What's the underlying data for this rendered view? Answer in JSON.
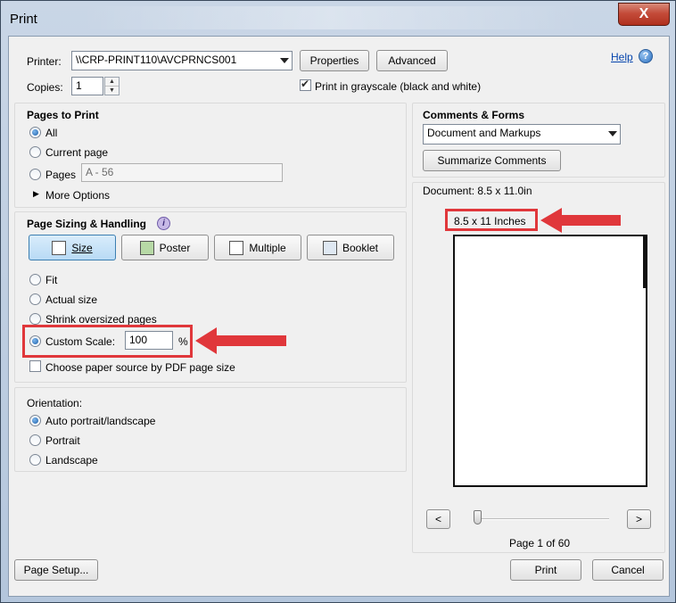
{
  "window": {
    "title": "Print",
    "close_glyph": "X"
  },
  "printer": {
    "label": "Printer:",
    "value": "\\\\CRP-PRINT110\\AVCPRNCS001",
    "properties_label": "Properties",
    "advanced_label": "Advanced",
    "help_label": "Help",
    "help_icon": "?"
  },
  "copies": {
    "label": "Copies:",
    "value": "1",
    "grayscale_label": "Print in grayscale (black and white)",
    "grayscale_checked": true
  },
  "pages_to_print": {
    "title": "Pages to Print",
    "options": [
      "All",
      "Current page",
      "Pages"
    ],
    "selected": "All",
    "pages_value": "A - 56",
    "more_options_label": "More Options"
  },
  "sizing": {
    "title": "Page Sizing & Handling",
    "info_icon": "i",
    "mode_buttons": [
      "Size",
      "Poster",
      "Multiple",
      "Booklet"
    ],
    "active_mode": "Size",
    "options": [
      "Fit",
      "Actual size",
      "Shrink oversized pages",
      "Custom Scale:"
    ],
    "selected": "Custom Scale:",
    "custom_scale_value": "100",
    "percent_sign": "%",
    "paper_source_label": "Choose paper source by PDF page size",
    "paper_source_checked": false
  },
  "orientation": {
    "title": "Orientation:",
    "options": [
      "Auto portrait/landscape",
      "Portrait",
      "Landscape"
    ],
    "selected": "Auto portrait/landscape"
  },
  "comments_forms": {
    "title": "Comments & Forms",
    "value": "Document and Markups",
    "summarize_label": "Summarize Comments"
  },
  "preview": {
    "document_size": "Document: 8.5 x 11.0in",
    "paper_label": "8.5 x 11 Inches",
    "prev_label": "<",
    "next_label": ">",
    "page_info": "Page 1 of 60",
    "slider_position": 0
  },
  "footer": {
    "page_setup_label": "Page Setup...",
    "print_label": "Print",
    "cancel_label": "Cancel"
  },
  "colors": {
    "annotation_red": "#e0373b",
    "active_mode_blue": "#b8daf5"
  }
}
